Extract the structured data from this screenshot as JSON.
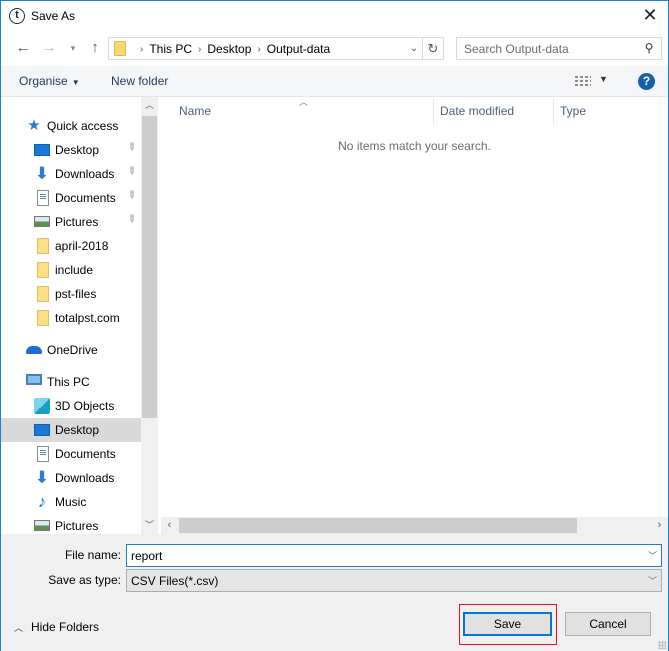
{
  "window": {
    "title": "Save As",
    "app_icon": "t-logo-icon",
    "close_icon": "close-icon",
    "accent_color": "#1883d7"
  },
  "navigation": {
    "back_icon": "back-arrow-icon",
    "forward_icon": "forward-arrow-icon",
    "recent_icon": "chevron-down-icon",
    "up_icon": "up-arrow-icon",
    "breadcrumbs": [
      "This PC",
      "Desktop",
      "Output-data"
    ],
    "separator": "›",
    "refresh_icon": "refresh-icon",
    "search_placeholder": "Search Output-data"
  },
  "toolbar": {
    "organise_label": "Organise",
    "new_folder_label": "New folder",
    "view_icon": "details-view-icon",
    "help_icon": "help-icon",
    "help_glyph": "?"
  },
  "sidebar": {
    "quick_access": {
      "label": "Quick access",
      "items": [
        {
          "label": "Desktop",
          "icon": "desktop-icon",
          "pinned": true
        },
        {
          "label": "Downloads",
          "icon": "downloads-icon",
          "pinned": true
        },
        {
          "label": "Documents",
          "icon": "documents-icon",
          "pinned": true
        },
        {
          "label": "Pictures",
          "icon": "pictures-icon",
          "pinned": true
        },
        {
          "label": "april-2018",
          "icon": "folder-icon",
          "pinned": false
        },
        {
          "label": "include",
          "icon": "folder-icon",
          "pinned": false
        },
        {
          "label": "pst-files",
          "icon": "folder-icon",
          "pinned": false
        },
        {
          "label": "totalpst.com",
          "icon": "folder-icon",
          "pinned": false
        }
      ]
    },
    "onedrive": {
      "label": "OneDrive"
    },
    "this_pc": {
      "label": "This PC",
      "items": [
        {
          "label": "3D Objects",
          "icon": "3d-objects-icon",
          "selected": false
        },
        {
          "label": "Desktop",
          "icon": "desktop-icon",
          "selected": true
        },
        {
          "label": "Documents",
          "icon": "documents-icon",
          "selected": false
        },
        {
          "label": "Downloads",
          "icon": "downloads-icon",
          "selected": false
        },
        {
          "label": "Music",
          "icon": "music-icon",
          "selected": false
        },
        {
          "label": "Pictures",
          "icon": "pictures-icon",
          "selected": false
        }
      ]
    }
  },
  "file_list": {
    "columns": [
      "Name",
      "Date modified",
      "Type"
    ],
    "sorted_by": "Name",
    "empty_message": "No items match your search."
  },
  "form": {
    "file_name_label": "File name:",
    "file_name_value": "report",
    "save_type_label": "Save as type:",
    "save_type_value": "CSV Files(*.csv)",
    "hide_folders_label": "Hide Folders",
    "save_label": "Save",
    "cancel_label": "Cancel",
    "highlight_color": "#e81123"
  }
}
